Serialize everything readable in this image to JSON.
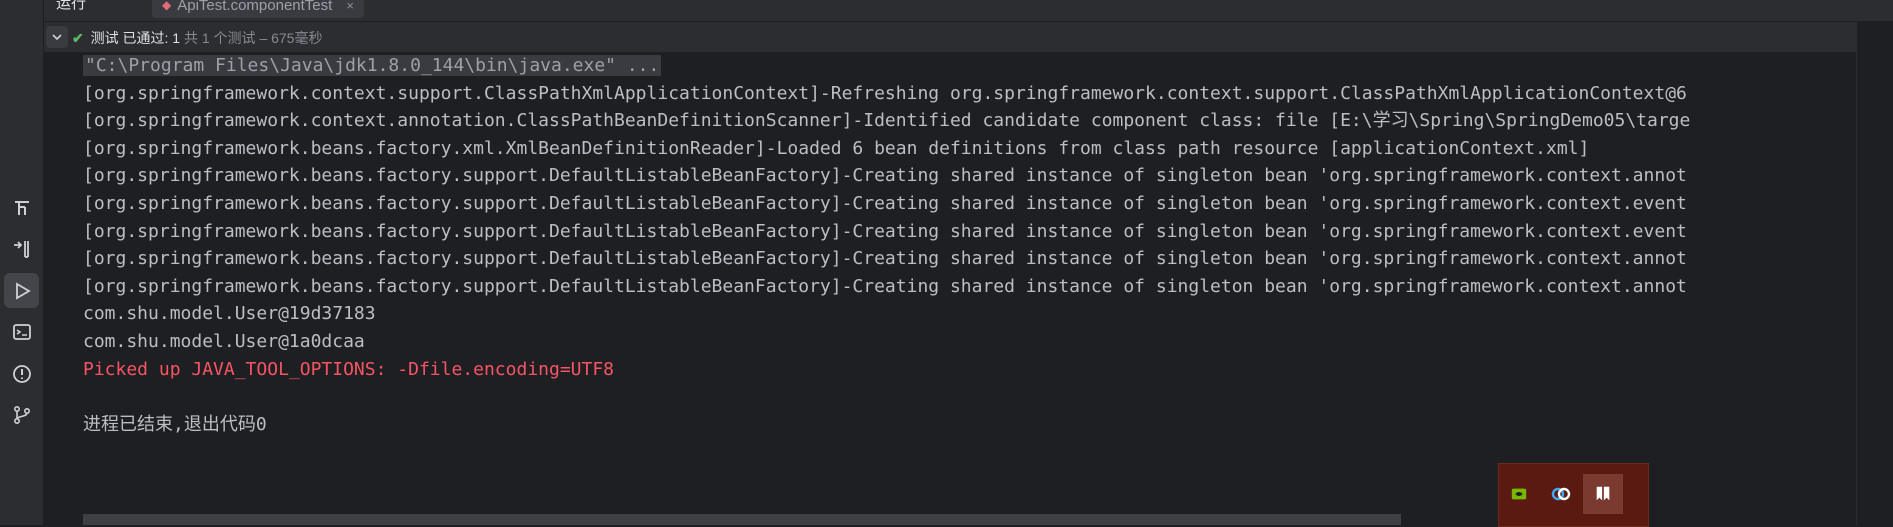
{
  "tabs": {
    "run_label": "运行",
    "file_tab": "ApiTest.componentTest",
    "close": "×"
  },
  "status": {
    "passed": "测试 已通过: 1",
    "details": "共 1 个测试 – 675毫秒"
  },
  "console": {
    "lines": [
      {
        "text": "\"C:\\Program Files\\Java\\jdk1.8.0_144\\bin\\java.exe\" ...",
        "kind": "cmd"
      },
      {
        "text": "[org.springframework.context.support.ClassPathXmlApplicationContext]-Refreshing org.springframework.context.support.ClassPathXmlApplicationContext@6",
        "kind": "normal"
      },
      {
        "text": "[org.springframework.context.annotation.ClassPathBeanDefinitionScanner]-Identified candidate component class: file [E:\\学习\\Spring\\SpringDemo05\\targe",
        "kind": "normal"
      },
      {
        "text": "[org.springframework.beans.factory.xml.XmlBeanDefinitionReader]-Loaded 6 bean definitions from class path resource [applicationContext.xml]",
        "kind": "normal"
      },
      {
        "text": "[org.springframework.beans.factory.support.DefaultListableBeanFactory]-Creating shared instance of singleton bean 'org.springframework.context.annot",
        "kind": "normal"
      },
      {
        "text": "[org.springframework.beans.factory.support.DefaultListableBeanFactory]-Creating shared instance of singleton bean 'org.springframework.context.event",
        "kind": "normal"
      },
      {
        "text": "[org.springframework.beans.factory.support.DefaultListableBeanFactory]-Creating shared instance of singleton bean 'org.springframework.context.event",
        "kind": "normal"
      },
      {
        "text": "[org.springframework.beans.factory.support.DefaultListableBeanFactory]-Creating shared instance of singleton bean 'org.springframework.context.annot",
        "kind": "normal"
      },
      {
        "text": "[org.springframework.beans.factory.support.DefaultListableBeanFactory]-Creating shared instance of singleton bean 'org.springframework.context.annot",
        "kind": "normal"
      },
      {
        "text": "com.shu.model.User@19d37183",
        "kind": "normal"
      },
      {
        "text": "com.shu.model.User@1a0dcaa",
        "kind": "normal"
      },
      {
        "text": "Picked up JAVA_TOOL_OPTIONS: -Dfile.encoding=UTF8",
        "kind": "err"
      },
      {
        "text": "",
        "kind": "normal"
      },
      {
        "text": "进程已结束,退出代码0",
        "kind": "normal"
      }
    ]
  },
  "sidebar": {
    "icons": [
      "font-icon",
      "structure-icon",
      "services-icon",
      "run-icon",
      "terminal-icon",
      "problems-icon",
      "git-icon"
    ]
  },
  "tray": {
    "icons": [
      "nvidia-icon",
      "baidu-netdisk-icon",
      "bookmark-app-icon"
    ]
  },
  "colors": {
    "background": "#1e1f22",
    "panel": "#2b2d30",
    "pass_green": "#5fb865",
    "error_red": "#f75464"
  }
}
